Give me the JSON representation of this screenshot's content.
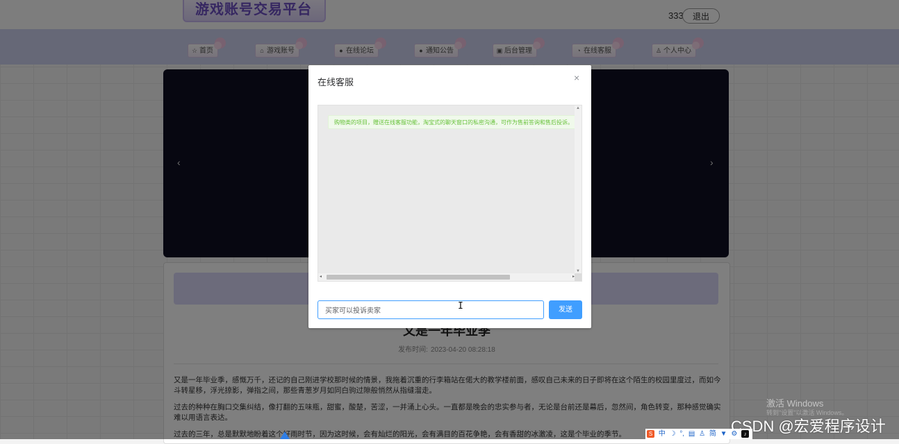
{
  "header": {
    "logo_text": "游戏账号交易平台",
    "username": "333",
    "logout_label": "退出"
  },
  "nav": [
    {
      "icon": "home-icon",
      "glyph": "☆",
      "label": "首页"
    },
    {
      "icon": "bag-icon",
      "glyph": "⌂",
      "label": "游戏账号"
    },
    {
      "icon": "forum-icon",
      "glyph": "●",
      "label": "在线论坛"
    },
    {
      "icon": "notice-icon",
      "glyph": "●",
      "label": "通知公告"
    },
    {
      "icon": "admin-icon",
      "glyph": "▣",
      "label": "后台管理"
    },
    {
      "icon": "service-icon",
      "glyph": "◔",
      "label": "在线客服"
    },
    {
      "icon": "user-icon",
      "glyph": "♙",
      "label": "个人中心"
    }
  ],
  "banner": {
    "prev_glyph": "‹",
    "next_glyph": "›"
  },
  "article": {
    "title": "又是一年毕业季",
    "time_label": "发布时间:",
    "time_value": "2023-04-20 08:28:18",
    "paragraphs": [
      "又是一年毕业季，感慨万千，还记的自己刚进学校那时候的情景，我拖着沉重的行李箱站在偌大的教学楼前面，感叹自己未来的日子即将在这个陌生的校园里度过，而如今斗转星移，浮光掠影，弹指之间，那些青葱岁月如同白驹过隙般悄然从指缝溜走。",
      "过去的种种在胸口交集纠结，像打翻的五味瓶，甜蜜，酸楚，苦涩，一并涌上心头。一直都是晚会的忠实参与者，无论是台前还是幕后，忽然间，角色转变，那种感觉确实难以用语言表达。",
      "过去的三年，总是默默地盼着这个好雨时节，因为这时候，会有灿烂的阳光，会有满目的百花争艳，会有香甜的冰激凌，这是个毕业的季节。"
    ]
  },
  "dialog": {
    "title": "在线客服",
    "close_glyph": "×",
    "system_message": "购物类的项目，赠送在线客服功能，淘宝式的聊天窗口的私密沟通，可作为售前答询和售后投诉。",
    "input_value": "买家可以投诉卖家",
    "send_label": "发送"
  },
  "watermark": {
    "activate": "激活 Windows",
    "activate_sub": "转到\"设置\"以激活 Windows。",
    "csdn": "CSDN @宏爱程序设计"
  },
  "tray": {
    "ime": "中",
    "simplified": "简"
  }
}
